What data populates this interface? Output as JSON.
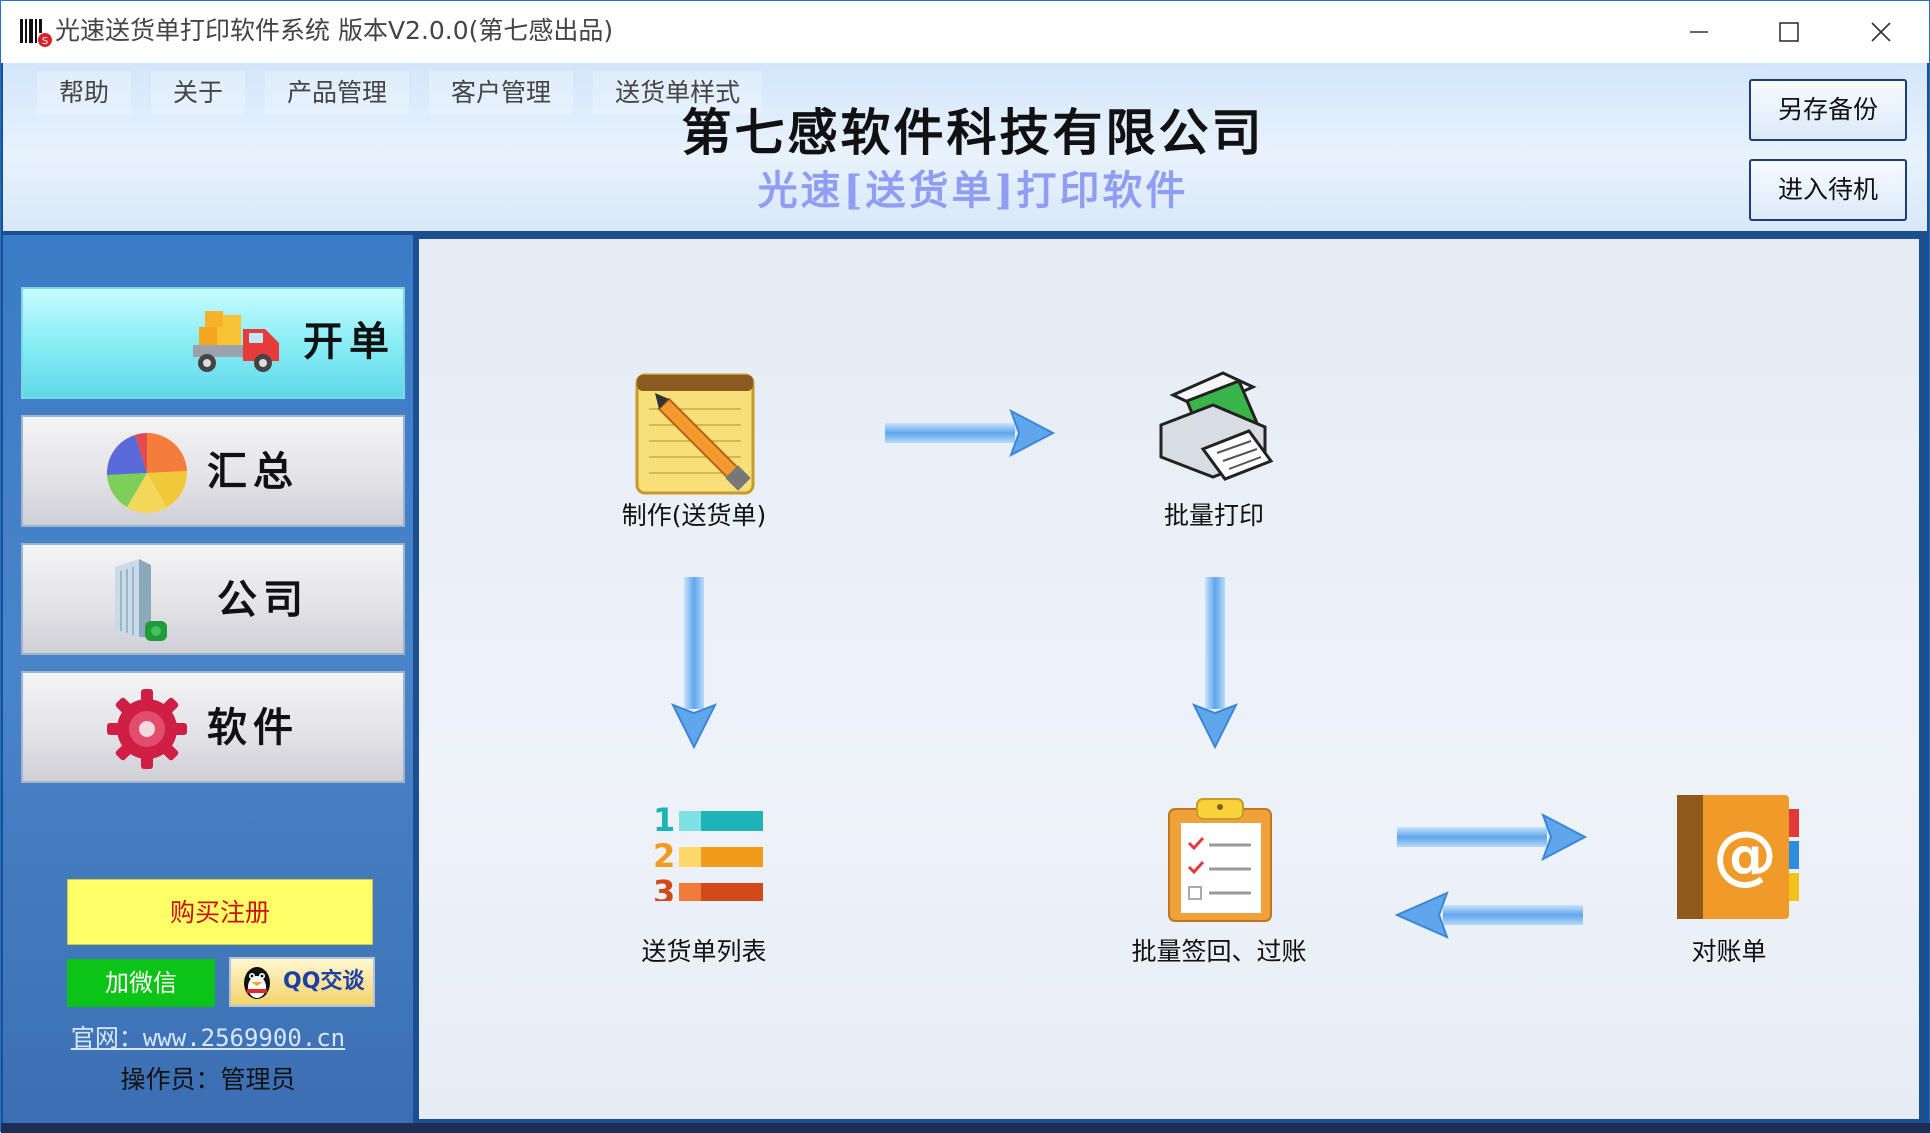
{
  "window": {
    "title": "光速送货单打印软件系统 版本V2.0.0(第七感出品)"
  },
  "menu": [
    {
      "label": "帮助"
    },
    {
      "label": "关于"
    },
    {
      "label": "产品管理"
    },
    {
      "label": "客户管理"
    },
    {
      "label": "送货单样式"
    }
  ],
  "header": {
    "company": "第七感软件科技有限公司",
    "product": "光速[送货单]打印软件",
    "backup_label": "另存备份",
    "standby_label": "进入待机"
  },
  "sidebar": {
    "nav": [
      {
        "label": "开单",
        "icon": "truck-icon",
        "active": true
      },
      {
        "label": "汇总",
        "icon": "pie-chart-icon",
        "active": false
      },
      {
        "label": "公司",
        "icon": "building-icon",
        "active": false
      },
      {
        "label": "软件",
        "icon": "gear-icon",
        "active": false
      }
    ],
    "buy_label": "购买注册",
    "wechat_label": "加微信",
    "qq_label": "QQ交谈",
    "website": "官网：www.2569900.cn",
    "operator": "操作员：管理员"
  },
  "workflow": {
    "make": "制作(送货单)",
    "batch_print": "批量打印",
    "list": "送货单列表",
    "sign_post": "批量签回、过账",
    "statement": "对账单"
  },
  "colors": {
    "accent": "#1b4f91",
    "buy_bg": "#ffff66",
    "buy_text": "#cc1111",
    "wechat_bg": "#0cc417",
    "active_nav": "#8eeff6"
  }
}
